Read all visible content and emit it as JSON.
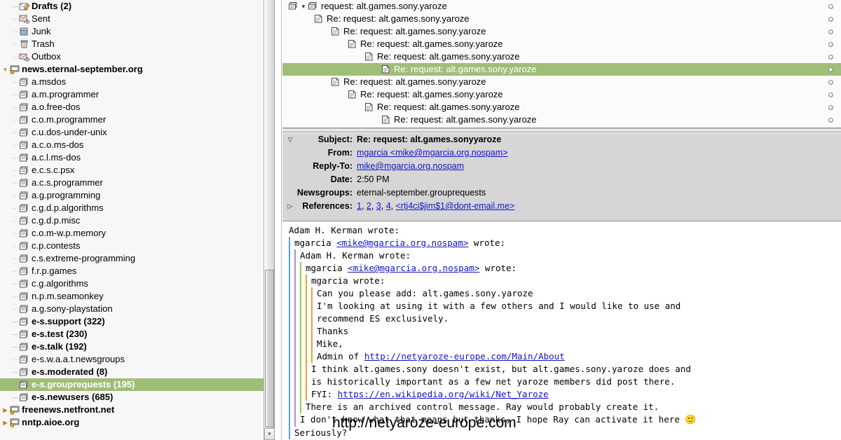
{
  "sidebar": {
    "items": [
      {
        "label": "Drafts (2)",
        "icon": "drafts-icon",
        "bold": true,
        "indent": 1,
        "selected": false,
        "twisty": ""
      },
      {
        "label": "Sent",
        "icon": "sent-icon",
        "bold": false,
        "indent": 1,
        "selected": false,
        "twisty": ""
      },
      {
        "label": "Junk",
        "icon": "junk-icon",
        "bold": false,
        "indent": 1,
        "selected": false,
        "twisty": ""
      },
      {
        "label": "Trash",
        "icon": "trash-icon",
        "bold": false,
        "indent": 1,
        "selected": false,
        "twisty": ""
      },
      {
        "label": "Outbox",
        "icon": "outbox-icon",
        "bold": false,
        "indent": 1,
        "selected": false,
        "twisty": ""
      },
      {
        "label": "news.eternal-september.org",
        "icon": "server-icon",
        "bold": true,
        "indent": 0,
        "selected": false,
        "twisty": "▼"
      },
      {
        "label": "a.msdos",
        "icon": "newsgroup-icon",
        "bold": false,
        "indent": 1,
        "selected": false,
        "twisty": ""
      },
      {
        "label": "a.m.programmer",
        "icon": "newsgroup-icon",
        "bold": false,
        "indent": 1,
        "selected": false,
        "twisty": ""
      },
      {
        "label": "a.o.free-dos",
        "icon": "newsgroup-icon",
        "bold": false,
        "indent": 1,
        "selected": false,
        "twisty": ""
      },
      {
        "label": "c.o.m.programmer",
        "icon": "newsgroup-icon",
        "bold": false,
        "indent": 1,
        "selected": false,
        "twisty": ""
      },
      {
        "label": "c.u.dos-under-unix",
        "icon": "newsgroup-icon",
        "bold": false,
        "indent": 1,
        "selected": false,
        "twisty": ""
      },
      {
        "label": "a.c.o.ms-dos",
        "icon": "newsgroup-icon",
        "bold": false,
        "indent": 1,
        "selected": false,
        "twisty": ""
      },
      {
        "label": "a.c.l.ms-dos",
        "icon": "newsgroup-icon",
        "bold": false,
        "indent": 1,
        "selected": false,
        "twisty": ""
      },
      {
        "label": "e.c.s.c.psx",
        "icon": "newsgroup-icon",
        "bold": false,
        "indent": 1,
        "selected": false,
        "twisty": ""
      },
      {
        "label": "a.c.s.programmer",
        "icon": "newsgroup-icon",
        "bold": false,
        "indent": 1,
        "selected": false,
        "twisty": ""
      },
      {
        "label": "a.g.programming",
        "icon": "newsgroup-icon",
        "bold": false,
        "indent": 1,
        "selected": false,
        "twisty": ""
      },
      {
        "label": "c.g.d.p.algorithms",
        "icon": "newsgroup-icon",
        "bold": false,
        "indent": 1,
        "selected": false,
        "twisty": ""
      },
      {
        "label": "c.g.d.p.misc",
        "icon": "newsgroup-icon",
        "bold": false,
        "indent": 1,
        "selected": false,
        "twisty": ""
      },
      {
        "label": "c.o.m-w.p.memory",
        "icon": "newsgroup-icon",
        "bold": false,
        "indent": 1,
        "selected": false,
        "twisty": ""
      },
      {
        "label": "c.p.contests",
        "icon": "newsgroup-icon",
        "bold": false,
        "indent": 1,
        "selected": false,
        "twisty": ""
      },
      {
        "label": "c.s.extreme-programming",
        "icon": "newsgroup-icon",
        "bold": false,
        "indent": 1,
        "selected": false,
        "twisty": ""
      },
      {
        "label": "f.r.p.games",
        "icon": "newsgroup-icon",
        "bold": false,
        "indent": 1,
        "selected": false,
        "twisty": ""
      },
      {
        "label": "c.g.algorithms",
        "icon": "newsgroup-icon",
        "bold": false,
        "indent": 1,
        "selected": false,
        "twisty": ""
      },
      {
        "label": "n.p.m.seamonkey",
        "icon": "newsgroup-icon",
        "bold": false,
        "indent": 1,
        "selected": false,
        "twisty": ""
      },
      {
        "label": "a.g.sony-playstation",
        "icon": "newsgroup-icon",
        "bold": false,
        "indent": 1,
        "selected": false,
        "twisty": ""
      },
      {
        "label": "e-s.support (322)",
        "icon": "newsgroup-icon",
        "bold": true,
        "indent": 1,
        "selected": false,
        "twisty": ""
      },
      {
        "label": "e-s.test (230)",
        "icon": "newsgroup-icon",
        "bold": true,
        "indent": 1,
        "selected": false,
        "twisty": ""
      },
      {
        "label": "e-s.talk (192)",
        "icon": "newsgroup-icon",
        "bold": true,
        "indent": 1,
        "selected": false,
        "twisty": ""
      },
      {
        "label": "e-s.w.a.a.t.newsgroups",
        "icon": "newsgroup-icon",
        "bold": false,
        "indent": 1,
        "selected": false,
        "twisty": ""
      },
      {
        "label": "e-s.moderated (8)",
        "icon": "newsgroup-icon",
        "bold": true,
        "indent": 1,
        "selected": false,
        "twisty": ""
      },
      {
        "label": "e-s.grouprequests (195)",
        "icon": "newsgroup-icon",
        "bold": true,
        "indent": 1,
        "selected": true,
        "twisty": ""
      },
      {
        "label": "e-s.newusers (685)",
        "icon": "newsgroup-icon",
        "bold": true,
        "indent": 1,
        "selected": false,
        "twisty": ""
      },
      {
        "label": "freenews.netfront.net",
        "icon": "server-icon",
        "bold": true,
        "indent": 0,
        "selected": false,
        "twisty": "▶"
      },
      {
        "label": "nntp.aioe.org",
        "icon": "server-icon",
        "bold": true,
        "indent": 0,
        "selected": false,
        "twisty": "▶"
      }
    ]
  },
  "thread_pane": {
    "rows": [
      {
        "subject": "request: alt.games.sony.yaroze",
        "depth": 0,
        "twisty": "▼",
        "selected": false,
        "icon": "thread-icon",
        "read_dot": true
      },
      {
        "subject": "Re: request: alt.games.sony.yaroze",
        "depth": 1,
        "twisty": "",
        "selected": false,
        "icon": "message-icon",
        "read_dot": true
      },
      {
        "subject": "Re: request: alt.games.sony.yaroze",
        "depth": 2,
        "twisty": "",
        "selected": false,
        "icon": "message-icon",
        "read_dot": true
      },
      {
        "subject": "Re: request: alt.games.sony.yaroze",
        "depth": 3,
        "twisty": "",
        "selected": false,
        "icon": "message-icon",
        "read_dot": true
      },
      {
        "subject": "Re: request: alt.games.sony.yaroze",
        "depth": 4,
        "twisty": "",
        "selected": false,
        "icon": "message-icon",
        "read_dot": true
      },
      {
        "subject": "Re: request: alt.games.sony.yaroze",
        "depth": 5,
        "twisty": "",
        "selected": true,
        "icon": "message-icon",
        "read_dot": true
      },
      {
        "subject": "Re: request: alt.games.sony.yaroze",
        "depth": 2,
        "twisty": "",
        "selected": false,
        "icon": "message-icon",
        "read_dot": true
      },
      {
        "subject": "Re: request: alt.games.sony.yaroze",
        "depth": 3,
        "twisty": "",
        "selected": false,
        "icon": "message-icon",
        "read_dot": true
      },
      {
        "subject": "Re: request: alt.games.sony.yaroze",
        "depth": 4,
        "twisty": "",
        "selected": false,
        "icon": "message-icon",
        "read_dot": true
      },
      {
        "subject": "Re: request: alt.games.sony.yaroze",
        "depth": 5,
        "twisty": "",
        "selected": false,
        "icon": "message-icon",
        "read_dot": true
      }
    ]
  },
  "header": {
    "twisty_collapse": "▽",
    "twisty_references": "▷",
    "subject_label": "Subject:",
    "subject_value": "Re: request: alt.games.sonyyaroze",
    "from_label": "From:",
    "from_value": "mgarcia <mike@mgarcia.org.nospam>",
    "replyto_label": "Reply-To:",
    "replyto_value": "mike@mgarcia.org.nospam",
    "date_label": "Date:",
    "date_value": "2:50 PM",
    "newsgroups_label": "Newsgroups:",
    "newsgroups_value": "eternal-september.grouprequests",
    "references_label": "References:",
    "references_links": [
      "1",
      "2",
      "3",
      "4"
    ],
    "references_msgid": "<rtj4ci$jim$1@dont-email.me>",
    "references_sep": ", "
  },
  "body": {
    "lines": [
      {
        "q": 0,
        "text": "Adam H. Kerman wrote:"
      },
      {
        "q": 1,
        "text": "mgarcia ",
        "link": "<mike@mgarcia.org.nospam>",
        "after": " wrote:"
      },
      {
        "q": 2,
        "text": "Adam H. Kerman wrote:"
      },
      {
        "q": 3,
        "text": "mgarcia ",
        "link": "<mike@mgarcia.org.nospam>",
        "after": " wrote:"
      },
      {
        "q": 4,
        "text": "mgarcia wrote:"
      },
      {
        "q": 5,
        "text": "Can you please add: alt.games.sony.yaroze"
      },
      {
        "q": 5,
        "text": "I'm looking at using it with a few others and I would like to use and"
      },
      {
        "q": 5,
        "text": "recommend ES exclusively."
      },
      {
        "q": 5,
        "text": "Thanks"
      },
      {
        "q": 5,
        "text": "Mike,"
      },
      {
        "q": 5,
        "text": "Admin of ",
        "link": "http://netyaroze-europe.com/Main/About",
        "after": ""
      },
      {
        "q": 4,
        "text": "I think alt.games.sony doesn't exist, but alt.games.sony.yaroze does and"
      },
      {
        "q": 4,
        "text": "is historically important as a few net yaroze members did post there."
      },
      {
        "q": 4,
        "text": "FYI: ",
        "link": "https://en.wikipedia.org/wiki/Net_Yaroze",
        "after": ""
      },
      {
        "q": 3,
        "text": "There is an archived control message. Ray would probably create it."
      },
      {
        "q": 2,
        "text": "I don't know what that means but thanks, I hope Ray can activate it here ",
        "emoji": "🙂"
      },
      {
        "q": 1,
        "text": "Seriously?"
      }
    ]
  },
  "overlay": {
    "url_text": "http://netyaroze-europe.com"
  },
  "colors": {
    "selection": "#9fbe78",
    "link": "#1414c8",
    "header_bg": "#d6d6d6",
    "sidebar_bg": "#f7f7f7",
    "quote1": "#5aa0e0",
    "quote2": "#b08cc8",
    "quote3": "#8ed14a",
    "quote4": "#f0a030"
  }
}
